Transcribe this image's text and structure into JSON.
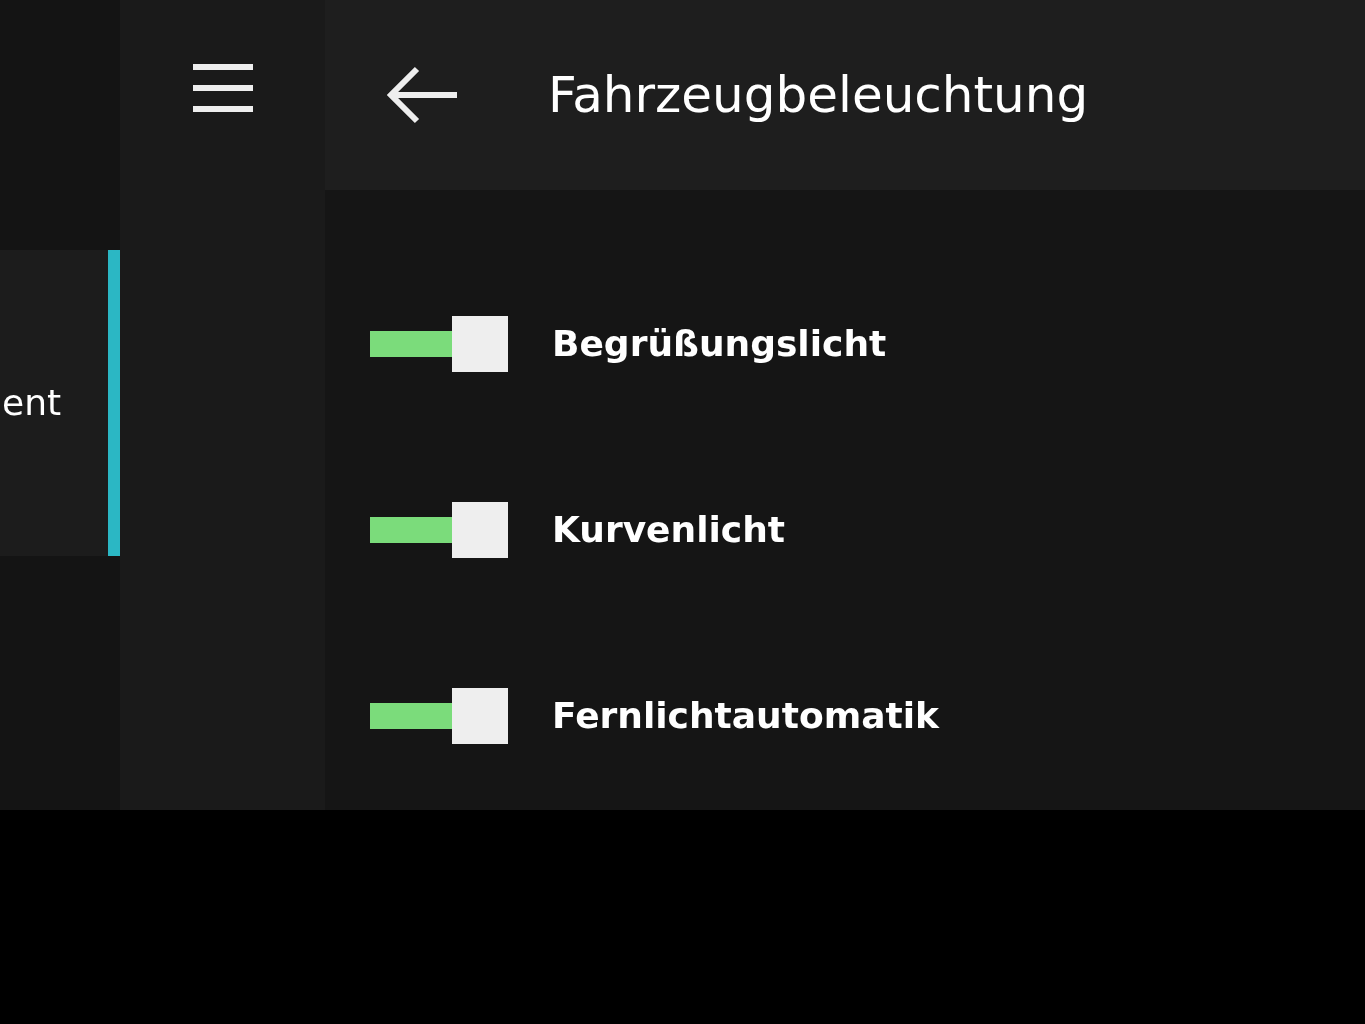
{
  "sidebar": {
    "items": [
      {
        "label": "ent",
        "selected": true
      }
    ]
  },
  "header": {
    "title": "Fahrzeugbeleuchtung"
  },
  "toggles": [
    {
      "label": "Begrüßungslicht",
      "on": true
    },
    {
      "label": "Kurvenlicht",
      "on": true
    },
    {
      "label": "Fernlichtautomatik",
      "on": true
    }
  ]
}
